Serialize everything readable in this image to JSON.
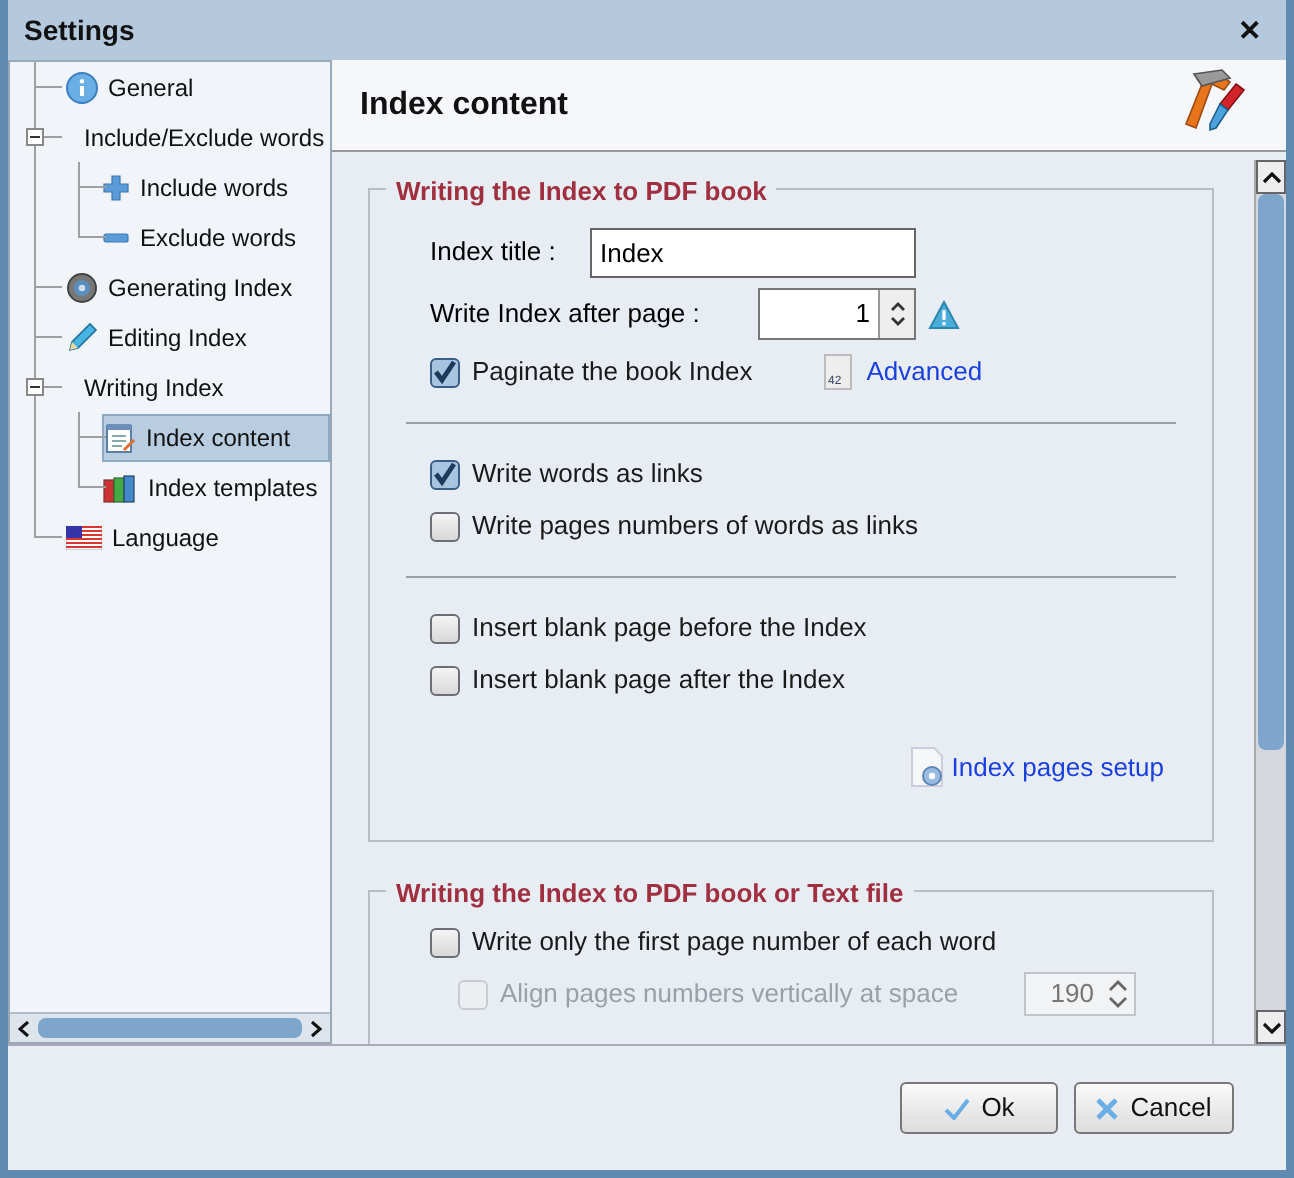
{
  "window": {
    "title": "Settings",
    "close": "✕"
  },
  "sidebar": {
    "items": [
      {
        "label": "General",
        "selected": false
      },
      {
        "label": "Include/Exclude words",
        "selected": false,
        "expanded": true,
        "children": [
          {
            "label": "Include words",
            "selected": false
          },
          {
            "label": "Exclude words",
            "selected": false
          }
        ]
      },
      {
        "label": "Generating Index",
        "selected": false
      },
      {
        "label": "Editing Index",
        "selected": false
      },
      {
        "label": "Writing Index",
        "selected": false,
        "expanded": true,
        "children": [
          {
            "label": "Index content",
            "selected": true
          },
          {
            "label": "Index templates",
            "selected": false
          }
        ]
      },
      {
        "label": "Language",
        "selected": false
      }
    ]
  },
  "panel": {
    "title": "Index content",
    "section_1": {
      "title": "Writing the Index to PDF book",
      "index_title": {
        "label": "Index title :",
        "value": "Index"
      },
      "after_page": {
        "label": "Write Index after page :",
        "value": "1",
        "warning": true
      },
      "paginate": {
        "label": "Paginate the book Index",
        "checked": true
      },
      "advanced_icon_number": "42",
      "advanced_link": "Advanced",
      "link_options": [
        {
          "label": "Write words as links",
          "checked": true
        },
        {
          "label": "Write pages numbers of words as links",
          "checked": false
        }
      ],
      "blank_options": [
        {
          "label": "Insert blank page before the Index",
          "checked": false
        },
        {
          "label": "Insert blank page after the Index",
          "checked": false
        }
      ],
      "setup_link": "Index pages setup"
    },
    "section_2": {
      "title": "Writing the Index to PDF book or Text file",
      "first_page_only": {
        "label": "Write only the first page number of each word",
        "checked": false
      },
      "align": {
        "label": "Align pages numbers vertically at space",
        "checked": false,
        "disabled": true,
        "value": "190"
      }
    }
  },
  "buttons": [
    {
      "kind": "ok",
      "label": "Ok"
    },
    {
      "kind": "cancel",
      "label": "Cancel"
    }
  ]
}
